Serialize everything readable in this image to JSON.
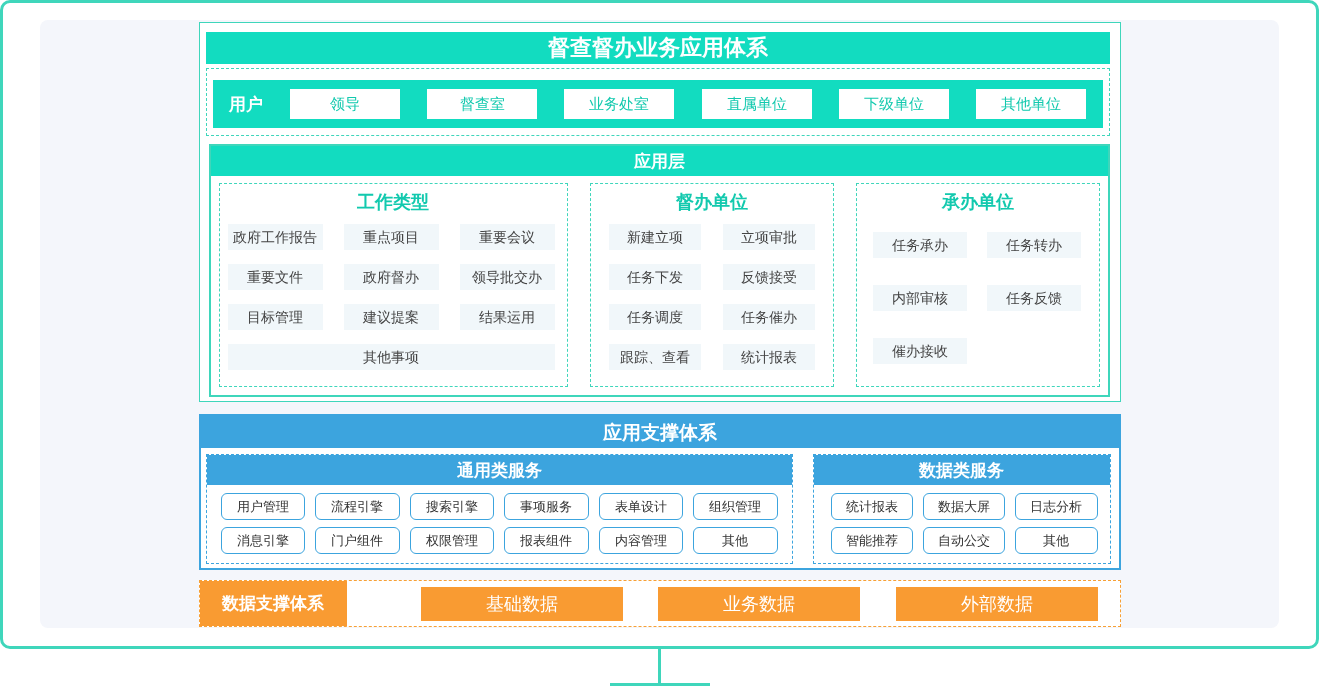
{
  "title": "督查督办业务应用体系",
  "users": {
    "label": "用户",
    "items": [
      "领导",
      "督查室",
      "业务处室",
      "直属单位",
      "下级单位",
      "其他单位"
    ]
  },
  "app_layer": {
    "title": "应用层",
    "groups": [
      {
        "title": "工作类型",
        "items": [
          "政府工作报告",
          "重点项目",
          "重要会议",
          "重要文件",
          "政府督办",
          "领导批交办",
          "目标管理",
          "建议提案",
          "结果运用",
          "其他事项"
        ]
      },
      {
        "title": "督办单位",
        "items": [
          "新建立项",
          "立项审批",
          "任务下发",
          "反馈接受",
          "任务调度",
          "任务催办",
          "跟踪、查看",
          "统计报表"
        ]
      },
      {
        "title": "承办单位",
        "items": [
          "任务承办",
          "任务转办",
          "内部审核",
          "任务反馈",
          "催办接收"
        ]
      }
    ]
  },
  "support": {
    "title": "应用支撑体系",
    "panels": [
      {
        "title": "通用类服务",
        "items": [
          "用户管理",
          "流程引擎",
          "搜索引擎",
          "事项服务",
          "表单设计",
          "组织管理",
          "消息引擎",
          "门户组件",
          "权限管理",
          "报表组件",
          "内容管理",
          "其他"
        ]
      },
      {
        "title": "数据类服务",
        "items": [
          "统计报表",
          "数据大屏",
          "日志分析",
          "智能推荐",
          "自动公交",
          "其他"
        ]
      }
    ]
  },
  "data_support": {
    "title": "数据支撑体系",
    "items": [
      "基础数据",
      "业务数据",
      "外部数据"
    ]
  }
}
